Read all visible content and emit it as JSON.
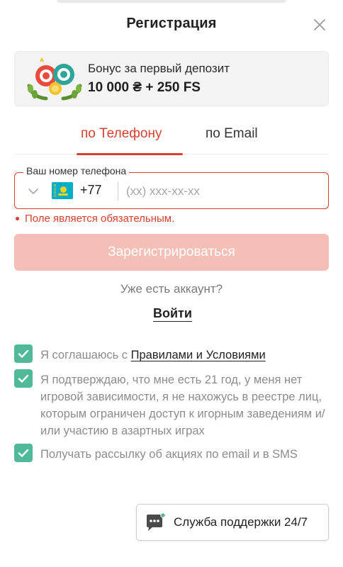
{
  "header": {
    "title": "Регистрация",
    "close_icon": "close-icon"
  },
  "bonus": {
    "title": "Бонус за первый депозит",
    "amount": "10 000 ₴ + 250 FS",
    "image_icon": "casino-chips-wreath-icon"
  },
  "tabs": [
    {
      "label": "по Телефону",
      "active": true
    },
    {
      "label": "по Email",
      "active": false
    }
  ],
  "phone": {
    "legend": "Ваш номер телефона",
    "country_flag": "kazakhstan-flag-icon",
    "dial_code": "+77",
    "value": "",
    "placeholder": "(xx) xxx-xx-xx"
  },
  "error": "Поле является обязательным.",
  "register_button": "Зарегистрироваться",
  "have_account": "Уже есть аккаунт?",
  "login_link": "Войти",
  "consents": [
    {
      "text_before": "Я соглашаюсь с ",
      "link": "Правилами и Условиями",
      "checked": true
    },
    {
      "text": "Я подтверждаю, что мне есть 21 год, у меня нет игровой зависимости, я не нахожусь в реестре лиц, которым ограничен доступ к игорным заведениям и/или участию в азартных играх",
      "checked": true
    },
    {
      "text": "Получать рассылку об акциях по email и в SMS",
      "checked": true
    }
  ],
  "support_button": "Служба поддержки 24/7",
  "colors": {
    "accent": "#d8412f",
    "button_disabled": "#f4bfb6",
    "checkbox": "#4fb99a"
  }
}
